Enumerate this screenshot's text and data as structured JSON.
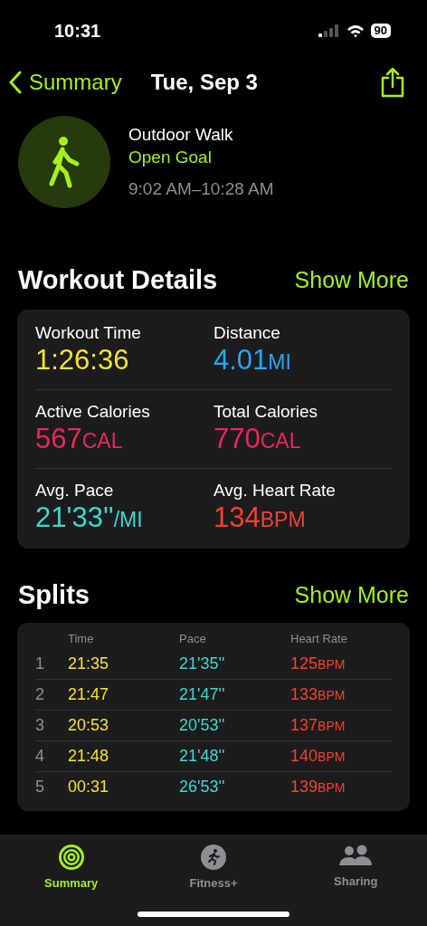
{
  "status_bar": {
    "time": "10:31",
    "battery": "90"
  },
  "nav": {
    "back_label": "Summary",
    "title": "Tue, Sep 3"
  },
  "workout": {
    "name": "Outdoor Walk",
    "goal": "Open Goal",
    "time_range": "9:02 AM–10:28 AM"
  },
  "details": {
    "title": "Workout Details",
    "action": "Show More",
    "metrics": [
      {
        "label": "Workout Time",
        "value": "1:26:36",
        "color": "#f5e22b"
      },
      {
        "label": "Distance",
        "value": "4.01",
        "unit": "MI",
        "color": "#22a8f0"
      },
      {
        "label": "Active Calories",
        "value": "567",
        "unit": "CAL",
        "color": "#f0245a"
      },
      {
        "label": "Total Calories",
        "value": "770",
        "unit": "CAL",
        "color": "#f0245a"
      },
      {
        "label": "Avg. Pace",
        "value": "21'33''",
        "unit": "/MI",
        "color": "#3ad9d0"
      },
      {
        "label": "Avg. Heart Rate",
        "value": "134",
        "unit": "BPM",
        "color": "#f5402a"
      }
    ]
  },
  "splits": {
    "title": "Splits",
    "action": "Show More",
    "columns": [
      "Time",
      "Pace",
      "Heart Rate"
    ],
    "rows": [
      {
        "index": "1",
        "time": "21:35",
        "pace": "21'35''",
        "heart_rate": "125",
        "unit": "BPM"
      },
      {
        "index": "2",
        "time": "21:47",
        "pace": "21'47''",
        "heart_rate": "133",
        "unit": "BPM"
      },
      {
        "index": "3",
        "time": "20:53",
        "pace": "20'53''",
        "heart_rate": "137",
        "unit": "BPM"
      },
      {
        "index": "4",
        "time": "21:48",
        "pace": "21'48''",
        "heart_rate": "140",
        "unit": "BPM"
      },
      {
        "index": "5",
        "time": "00:31",
        "pace": "26'53''",
        "heart_rate": "139",
        "unit": "BPM"
      }
    ]
  },
  "tab_bar": [
    {
      "label": "Summary",
      "selected": true
    },
    {
      "label": "Fitness+",
      "selected": false
    },
    {
      "label": "Sharing",
      "selected": false
    }
  ]
}
